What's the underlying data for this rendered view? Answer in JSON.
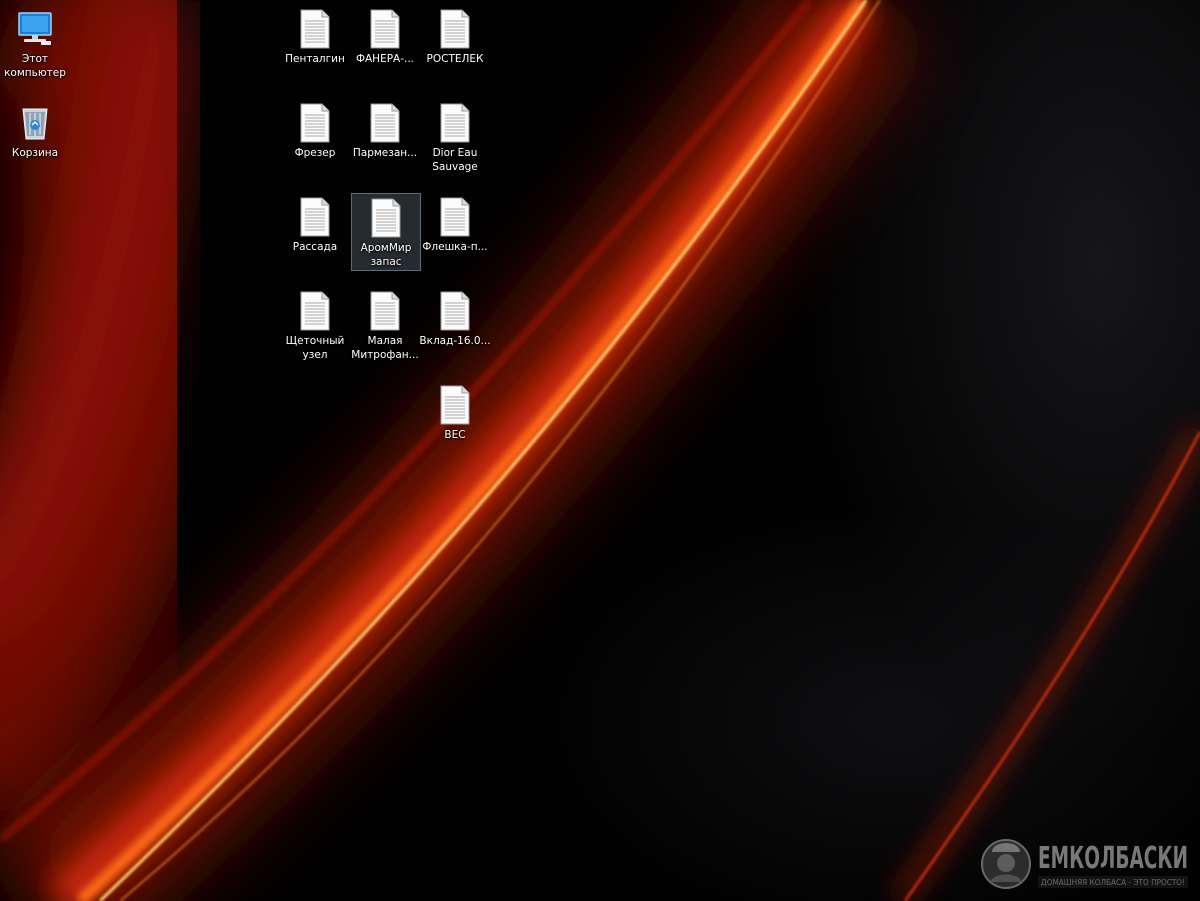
{
  "desktop": {
    "system_icons": [
      {
        "name": "this-pc",
        "label": "Этот\nкомпьютер",
        "icon": "computer-icon"
      },
      {
        "name": "recycle-bin",
        "label": "Корзина",
        "icon": "recycle-bin-icon"
      }
    ],
    "files": [
      {
        "label": "Пенталгин",
        "icon": "text-document-icon"
      },
      {
        "label": "ФАНЕРА-...",
        "icon": "text-document-icon"
      },
      {
        "label": "РОСТЕЛЕК",
        "icon": "text-document-icon"
      },
      {
        "label": "Фрезер",
        "icon": "text-document-icon"
      },
      {
        "label": "Пармезан...",
        "icon": "text-document-icon"
      },
      {
        "label": "Dior Eau\nSauvage",
        "icon": "text-document-icon"
      },
      {
        "label": "Рассада",
        "icon": "text-document-icon"
      },
      {
        "label": "АромМир\nзапас",
        "icon": "text-document-icon",
        "selected": true
      },
      {
        "label": "Флешка-п...",
        "icon": "text-document-icon"
      },
      {
        "label": "Щеточный\nузел",
        "icon": "text-document-icon"
      },
      {
        "label": "Малая\nМитрофан...",
        "icon": "text-document-icon"
      },
      {
        "label": "Вклад-16.0...",
        "icon": "text-document-icon"
      },
      {
        "label": "ВЕС",
        "icon": "text-document-icon"
      }
    ]
  },
  "watermark": {
    "brand": "ЕМКОЛБАСКИ",
    "tagline": "ДОМАШНЯЯ КОЛБАСА - ЭТО ПРОСТО!"
  },
  "colors": {
    "accent_red": "#d42a0a",
    "accent_orange": "#ff7a1a",
    "accent_yellow": "#ffe27a",
    "selection": "#cce8ff"
  }
}
